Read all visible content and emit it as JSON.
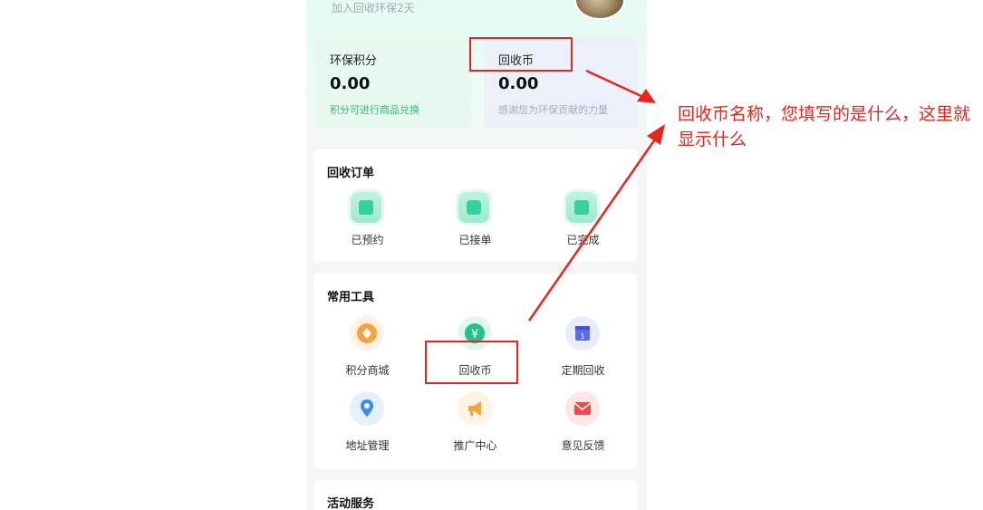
{
  "profile": {
    "join_text": "加入回收环保2天"
  },
  "cards": {
    "points": {
      "title": "环保积分",
      "value": "0.00",
      "subtitle": "积分可进行商品兑换"
    },
    "coins": {
      "title": "回收币",
      "value": "0.00",
      "subtitle": "感谢您为环保贡献的力量"
    }
  },
  "orders": {
    "title": "回收订单",
    "items": [
      {
        "label": "已预约",
        "icon": "calendar-icon"
      },
      {
        "label": "已接单",
        "icon": "order-check-icon"
      },
      {
        "label": "已完成",
        "icon": "checkbox-done-icon"
      }
    ]
  },
  "tools": {
    "title": "常用工具",
    "items": [
      {
        "label": "积分商城",
        "icon": "points-diamond-icon",
        "color": "#f7a23b"
      },
      {
        "label": "回收币",
        "icon": "yuan-coin-icon",
        "color": "#27c08a"
      },
      {
        "label": "定期回收",
        "icon": "calendar-one-icon",
        "color": "#5b6ee8"
      },
      {
        "label": "地址管理",
        "icon": "location-pin-icon",
        "color": "#3b8cf0"
      },
      {
        "label": "推广中心",
        "icon": "megaphone-icon",
        "color": "#f7a23b"
      },
      {
        "label": "意见反馈",
        "icon": "mail-icon",
        "color": "#ef4b4b"
      }
    ]
  },
  "activity": {
    "title": "活动服务"
  },
  "annotation": {
    "text": "回收币名称，您填写的是什么，这里就显示什么",
    "color": "#e8241c"
  }
}
